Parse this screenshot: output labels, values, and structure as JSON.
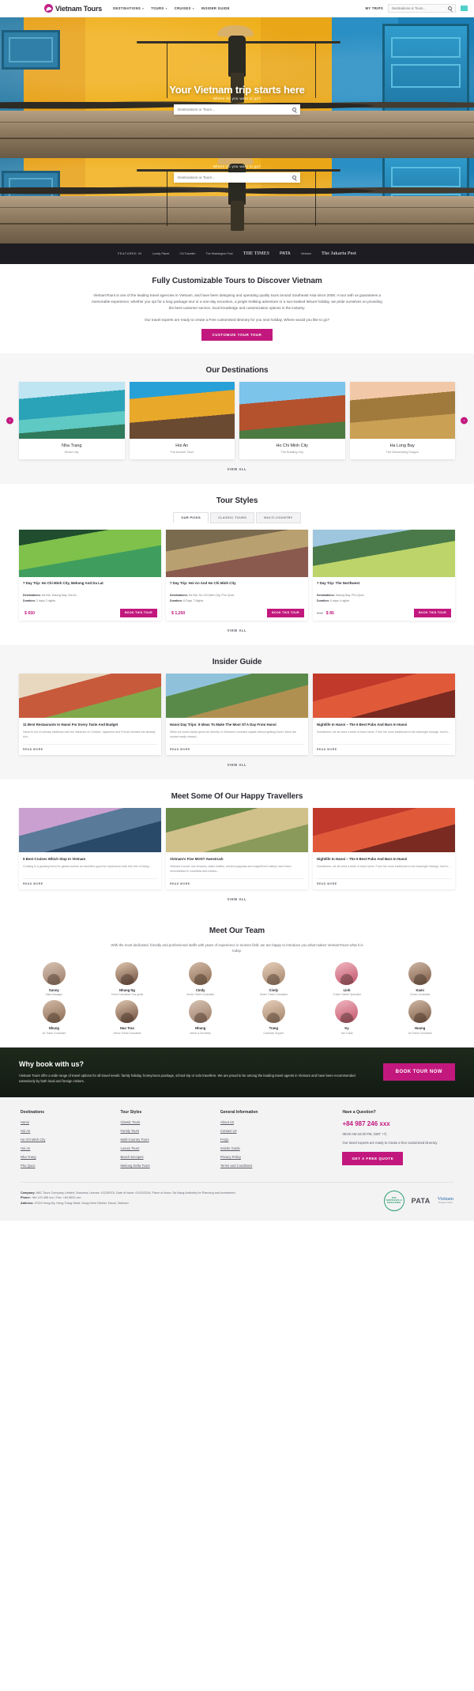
{
  "header": {
    "logo_text": "Vietnam Tours",
    "nav": [
      {
        "label": "DESTINATIONS",
        "caret": true
      },
      {
        "label": "TOURS",
        "caret": true
      },
      {
        "label": "CRUISES",
        "caret": true
      },
      {
        "label": "INSIDER GUIDE",
        "caret": false
      }
    ],
    "my_trips": "MY TRIPS",
    "search_placeholder": "Destinations or Tours..."
  },
  "hero": {
    "title": "Your Vietnam trip starts here",
    "subtitle": "Where do you want to go?",
    "search_placeholder": "Destinations or Tours..."
  },
  "hero2": {
    "subtitle": "Where do you want to go?",
    "search_placeholder": "Destinations or Tours..."
  },
  "featured": {
    "label": "FEATURED IN",
    "logos": [
      "Lonely Planet",
      "CN Traveller",
      "The Washington Post",
      "THE TIMES",
      "PATA",
      "Vietnam",
      "The Jakarta Post"
    ]
  },
  "intro": {
    "title": "Fully Customizable Tours to Discover Vietnam",
    "paragraph1": "VietnamTours is one of the leading travel agencies in Vietnam, and have been designing and operating quality tours around Southeast Asia since 2008. A tour with us guarantees a memorable experience; whether you opt for a long package tour or a one-day excursion, a jungle trekking adventure or a sun-soaked leisure holiday, we pride ourselves on providing the best customer service, local knowledge and customization options in the industry.",
    "paragraph2": "Our travel experts are ready to create a Free customised itinerary for you next holiday. Where would you like to go?",
    "cta": "CUSTOMIZE YOUR TOUR"
  },
  "destinations": {
    "title": "Our Destinations",
    "prev": "‹",
    "next": "›",
    "view_all": "VIEW ALL",
    "items": [
      {
        "name": "Nha Trang",
        "tagline": "Beach city"
      },
      {
        "name": "Hoi An",
        "tagline": "The Ancient Town"
      },
      {
        "name": "Ho Chi Minh City",
        "tagline": "The Bustling City"
      },
      {
        "name": "Ha Long Bay",
        "tagline": "The Descending Dragon"
      }
    ]
  },
  "tour_styles": {
    "title": "Tour Styles",
    "tabs": [
      {
        "label": "OUR PICKS",
        "active": true
      },
      {
        "label": "CLASSIC TOURS",
        "active": false
      },
      {
        "label": "MULTI-COUNTRY",
        "active": false
      }
    ],
    "view_all": "VIEW ALL",
    "book_label": "BOOK THIS TOUR",
    "dest_label": "Destinations:",
    "dur_label": "Duration:",
    "tours": [
      {
        "name": "7 Day Trip: Ho Chi Minh City, Mekong And Da Lat",
        "destinations": "Hà Nội, Halong Bay, Hội An",
        "duration": "3 days 2 nights",
        "price": "$ 650",
        "price_old": ""
      },
      {
        "name": "7 Day Trip: Hoi An And Ho Chi Minh City",
        "destinations": "Hà Nội, Ho Chi Minh City, Phú Quốc",
        "duration": "8 Days 7 Nights",
        "price": "$ 1,250",
        "price_old": ""
      },
      {
        "name": "7 Day Trip: The Northwest",
        "destinations": "Halong Bay, Phú Quốc",
        "duration": "5 days 4 nights",
        "price": "$ 85",
        "price_old": "$ 98"
      }
    ]
  },
  "insider_guide": {
    "title": "Insider Guide",
    "view_all": "VIEW ALL",
    "read_more": "READ MORE",
    "articles": [
      {
        "title": "11 Best Restaurants In Hanoi For Every Taste And Budget",
        "excerpt": "Hanoi is full of culinary traditions with the influence of Chinese, Japanese and French besides the already rich..."
      },
      {
        "title": "Hanoi Day Trips: 9 Ideas To Make The Most Of A Day From Hanoi",
        "excerpt": "While we could easily spend an eternity in Vietnam's crowded capital without getting bored, there are myriad easily missed..."
      },
      {
        "title": "Nightlife In Hanoi – The 5 Best Pubs And Bars In Hanoi",
        "excerpt": "Sometimes, we all need a taste of back home. From the more traditional to the downright strange, here's..."
      }
    ]
  },
  "travellers": {
    "title": "Meet Some Of Our Happy Travellers",
    "view_all": "VIEW ALL",
    "read_more": "READ MORE",
    "articles": [
      {
        "title": "5 Best Cruises Which Stop In Vietnam",
        "excerpt": "Cruising is a growing trend for global tourism as travellers good for experience both this feel of being..."
      },
      {
        "title": "Vietnam's Five MOST Awestruck",
        "excerpt": "Vietnam's iconic rice terraces, water buffalo, ancient pagodas and magnificent valleys have been immortalized in countless and means..."
      },
      {
        "title": "Nightlife In Hanoi – The 5 Best Pubs And Bars In Hanoi",
        "excerpt": "Sometimes, we all need a taste of back home. From the more traditional to the downright strange, here's..."
      }
    ]
  },
  "team": {
    "title": "Meet Our Team",
    "intro": "With the most dedicated, friendly and professional staffs with years of experience in tourism field, we are happy to introduce you what makes VietnamTours what it is today.",
    "members": [
      {
        "name": "Sunny",
        "role": "Sales Manager"
      },
      {
        "name": "Nhung Ng",
        "role": "Travel Consultant Tour guide"
      },
      {
        "name": "Cindy",
        "role": "Senior Travel Consultant"
      },
      {
        "name": "Cindy",
        "role": "Senior Travel Consultant"
      },
      {
        "name": "Linh",
        "role": "Cruise Charter Specialist"
      },
      {
        "name": "Kami",
        "role": "Cruise Consultant"
      },
      {
        "name": "Nhung",
        "role": "Air Travel Consultant"
      },
      {
        "name": "Hao Tran",
        "role": "Senior Travel Consultant"
      },
      {
        "name": "Nhung",
        "role": "Admin & Secretary"
      },
      {
        "name": "Trang",
        "role": "Customer Support"
      },
      {
        "name": "Ky",
        "role": "Tour Guide"
      },
      {
        "name": "Huong",
        "role": "Air Travel Consultant"
      }
    ]
  },
  "why_book": {
    "title": "Why book with us?",
    "paragraph": "Vietnam Tours offer a wide range of travel options for all travel needs: family holiday, honeymoon package, school trip or solo travellers. We are proud to be among the leading travel agents in Vietnam and have been recommended extensively by both local and foreign visitors.",
    "cta": "BOOK TOUR NOW"
  },
  "footer": {
    "columns": [
      {
        "head": "Destinations",
        "links": [
          "Hanoi",
          "Hoi An",
          "Ho Chi Minh City",
          "Hoi An",
          "Nha Trang",
          "Phu Quoc"
        ]
      },
      {
        "head": "Tour Styles",
        "links": [
          "Classic Tours",
          "Family Tours",
          "Multi-Country Tours",
          "Luxury Tours",
          "Beach Escapes",
          "Mekong Delta Tours"
        ]
      },
      {
        "head": "General Information",
        "links": [
          "About Us",
          "Contact Us",
          "FAQs",
          "Insider Guide",
          "Privacy Policy",
          "Terms and Conditions"
        ]
      }
    ],
    "question": {
      "head": "Have a Question?",
      "phone": "+84 987 246 xxx",
      "hours": "08:00 AM-22:00 PM, GMT +7)",
      "note": "Our travel experts are ready to create a free customized itinerary.",
      "cta": "GET A FREE QUOTE"
    },
    "legal": {
      "company_label": "Company:",
      "company": "ABC Tours Company Limited, Business License: 01234578, Date of Issue: 01/02/2016, Place of Issue: Da Nang Authority for Planning and Investment.",
      "phone_label": "Phone:",
      "phone": "+84 123 456 xxx / Fax: +84 5632-xxx",
      "address_label": "Address:",
      "address": "1F/24 Hung My, Hung Trang Ward, Hung Kiem District, Hanoi, Vietnam"
    },
    "badges": [
      {
        "type": "tripadvisor",
        "line1": "2019",
        "line2": "CERTIFICATE of",
        "line3": "EXCELLENCE"
      },
      {
        "type": "pata",
        "text": "PATA"
      },
      {
        "type": "vietnam",
        "text": "Vietnam",
        "sub": "Timeless Charm"
      }
    ]
  }
}
